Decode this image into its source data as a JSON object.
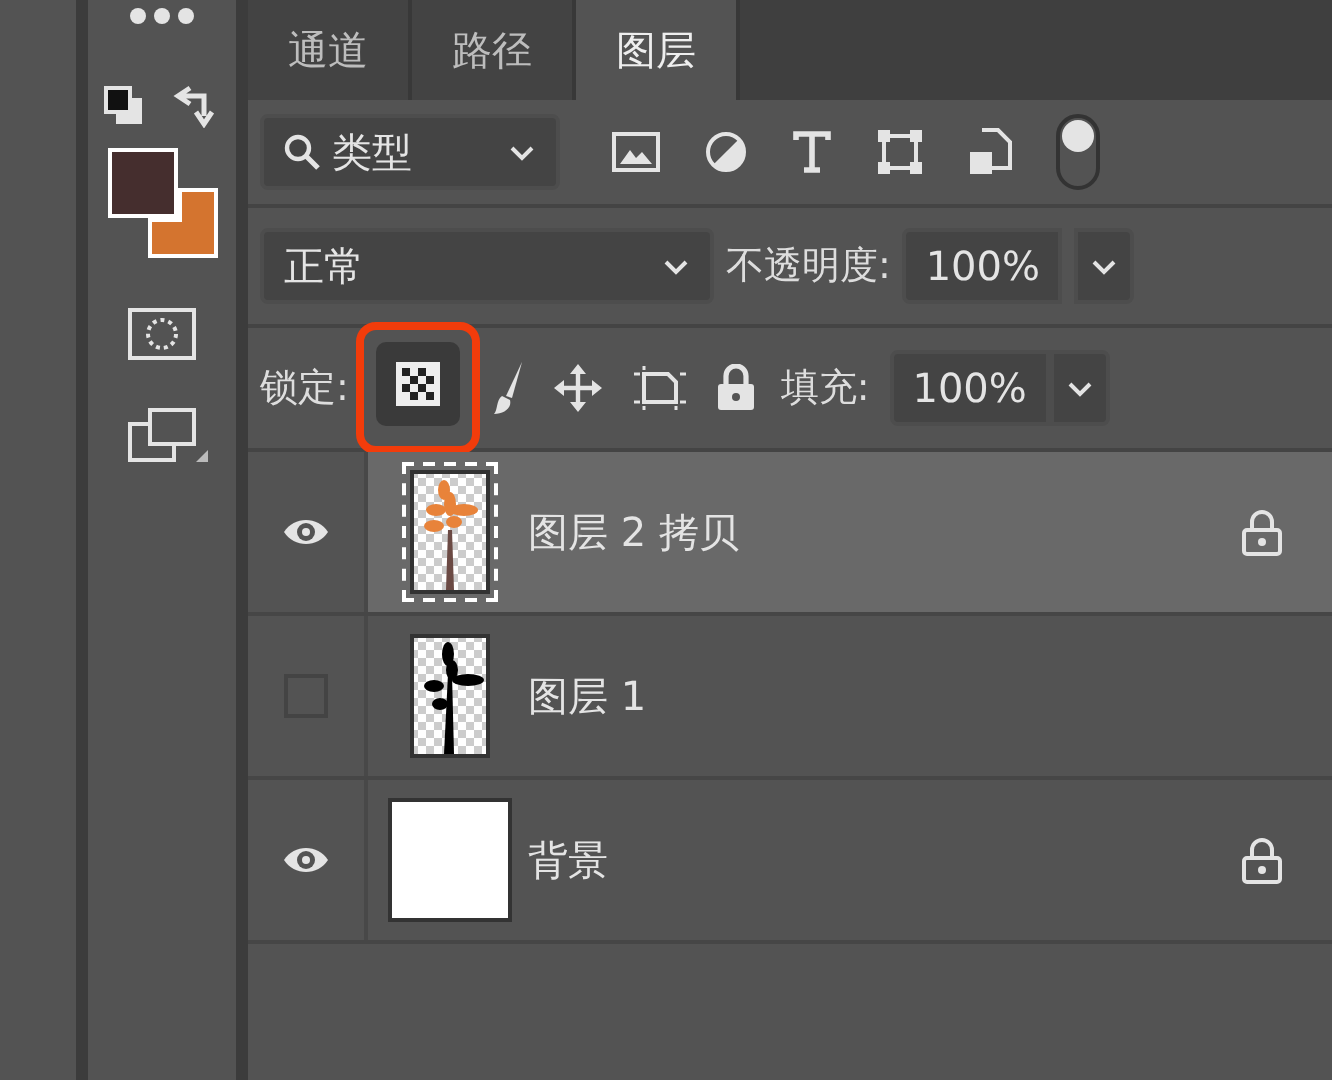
{
  "tabs": [
    {
      "label": "通道",
      "selected": false
    },
    {
      "label": "路径",
      "selected": false
    },
    {
      "label": "图层",
      "selected": true
    }
  ],
  "tools": {
    "swatches": [
      {
        "kind": "foreground",
        "color": "#452e2e"
      },
      {
        "kind": "background",
        "color": "#d4742f"
      }
    ]
  },
  "filter": {
    "label": "类型"
  },
  "blend_mode": {
    "value": "正常"
  },
  "opacity": {
    "label": "不透明度:",
    "value": "100%"
  },
  "lock": {
    "label": "锁定:",
    "buttons": [
      {
        "kind": "transparent",
        "selected": true
      },
      {
        "kind": "pixels",
        "selected": false
      },
      {
        "kind": "position",
        "selected": false
      },
      {
        "kind": "artboard",
        "selected": false
      },
      {
        "kind": "all",
        "selected": false
      }
    ]
  },
  "fill": {
    "label": "填充:",
    "value": "100%"
  },
  "layers": [
    {
      "name": "图层 2 拷贝",
      "kind": "orange-tree",
      "visible": true,
      "selected": true,
      "locked": true
    },
    {
      "name": "图层 1",
      "kind": "black-tree",
      "visible": false,
      "selected": false,
      "locked": false
    },
    {
      "name": "背景",
      "kind": "white",
      "visible": true,
      "selected": false,
      "locked": true
    }
  ]
}
